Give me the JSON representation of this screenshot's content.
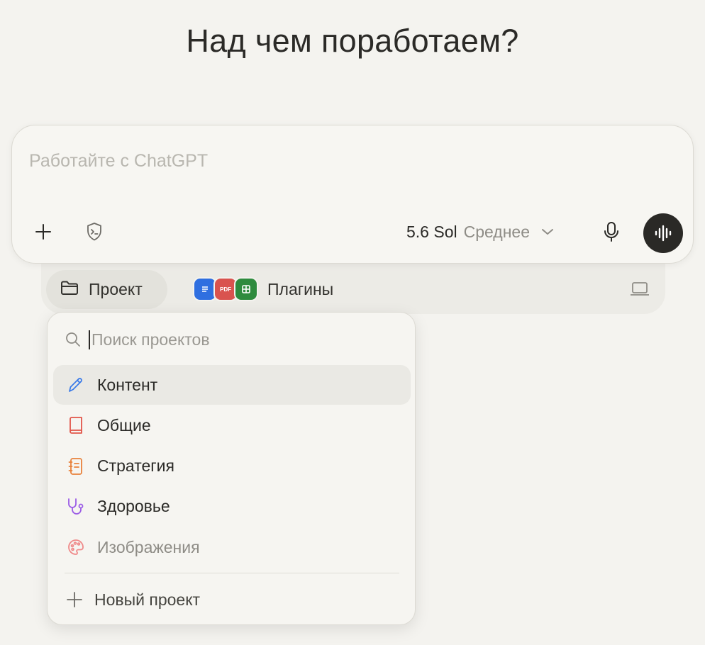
{
  "headline": "Над чем поработаем?",
  "composer": {
    "placeholder": "Работайте с ChatGPT",
    "model_name": "5.6 Sol",
    "model_mode": "Среднее"
  },
  "tray": {
    "project_label": "Проект",
    "plugins_label": "Плагины",
    "plugin_icons": [
      "docs-icon",
      "pdf-icon",
      "sheets-icon"
    ],
    "pdf_badge": "PDF"
  },
  "dropdown": {
    "search_placeholder": "Поиск проектов",
    "items": [
      {
        "label": "Контент",
        "icon": "pencil-icon",
        "color": "#3b7be8",
        "active": true
      },
      {
        "label": "Общие",
        "icon": "book-icon",
        "color": "#e2554a"
      },
      {
        "label": "Стратегия",
        "icon": "notebook-icon",
        "color": "#e8813b"
      },
      {
        "label": "Здоровье",
        "icon": "stethoscope-icon",
        "color": "#9b5ce6"
      },
      {
        "label": "Изображения",
        "icon": "palette-icon",
        "color": "#ef8a8a"
      }
    ],
    "new_project_label": "Новый проект"
  },
  "colors": {
    "background": "#f4f3ef",
    "voice_button": "#2a2926"
  }
}
